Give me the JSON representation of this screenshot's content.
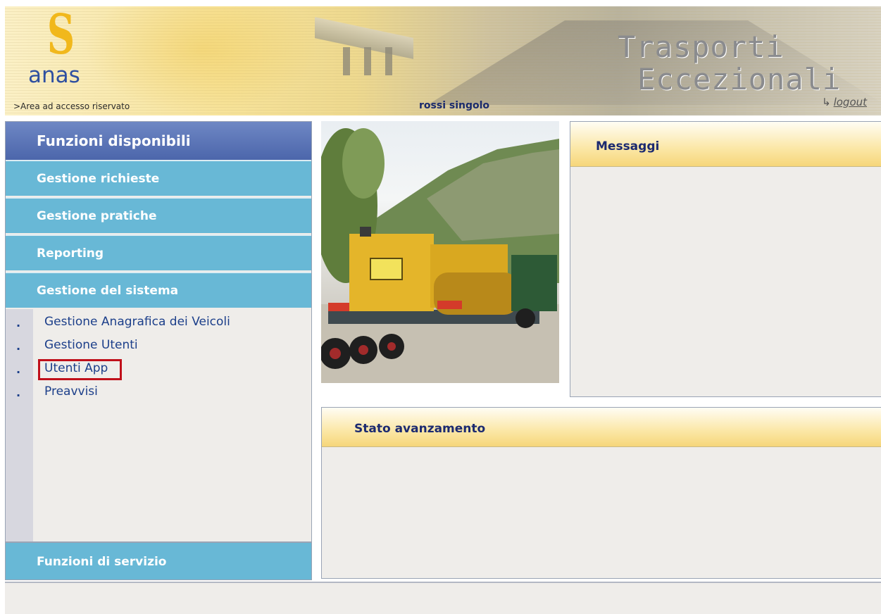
{
  "header": {
    "logo_text": "anas",
    "brand_line1": "Trasporti",
    "brand_line2": "Eccezionali",
    "reserved_area": ">Area ad accesso riservato",
    "username": "rossi singolo",
    "logout_label": "logout",
    "logout_icon": "logout-arrow-icon"
  },
  "sidebar": {
    "title": "Funzioni disponibili",
    "items": [
      {
        "label": "Gestione richieste"
      },
      {
        "label": "Gestione pratiche"
      },
      {
        "label": "Reporting"
      },
      {
        "label": "Gestione del sistema"
      }
    ],
    "subitems": [
      {
        "label": "Gestione Anagrafica dei Veicoli"
      },
      {
        "label": "Gestione Utenti"
      },
      {
        "label": "Utenti App",
        "highlighted": true
      },
      {
        "label": "Preavvisi"
      }
    ],
    "bottom": "Funzioni di servizio"
  },
  "panels": {
    "messages_title": "Messaggi",
    "progress_title": "Stato avanzamento"
  },
  "colors": {
    "sidebar_header": "#4c66ab",
    "sidebar_item": "#68b8d6",
    "panel_header": "#f6d67a",
    "link": "#1c3f8a",
    "highlight": "#c0101a"
  }
}
